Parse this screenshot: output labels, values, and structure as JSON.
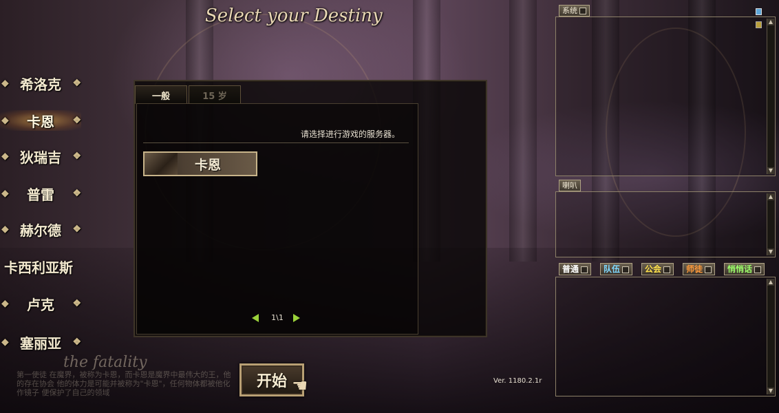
{
  "title": "Select your Destiny",
  "characters": [
    {
      "label": "希洛克",
      "active": false
    },
    {
      "label": "卡恩",
      "active": true
    },
    {
      "label": "狄瑞吉",
      "active": false
    },
    {
      "label": "普雷",
      "active": false
    },
    {
      "label": "赫尔德",
      "active": false
    },
    {
      "label": "卡西利亚斯",
      "active": false
    },
    {
      "label": "卢克",
      "active": false
    },
    {
      "label": "塞丽亚",
      "active": false
    }
  ],
  "background_text": {
    "subtitle": "the fatality",
    "story": "第一使徒 在魔界，被称为卡恩，而卡恩是魔界中最伟大的王，他的存在协会 他的体力是可能并被称为\"卡恩\"，任何物体都被他化作镜子 便保护了自己的领域"
  },
  "panel": {
    "tabs": [
      {
        "label": "一般",
        "active": true
      },
      {
        "label": "15 岁",
        "active": false
      }
    ],
    "instruction": "请选择进行游戏的服务器。",
    "servers": [
      {
        "name": "卡恩"
      }
    ],
    "pager": {
      "text": "1\\1"
    }
  },
  "start_button": {
    "label": "开始"
  },
  "version": "Ver. 1180.2.1r",
  "right_panel": {
    "system_label": "系统",
    "speaker_label": "喇叭",
    "channels": [
      {
        "label": "普通",
        "color": "#ffffff"
      },
      {
        "label": "队伍",
        "color": "#7fd8ff"
      },
      {
        "label": "公会",
        "color": "#ffe14a"
      },
      {
        "label": "师徒",
        "color": "#ff9a3a"
      },
      {
        "label": "悄悄话",
        "color": "#9cff6a"
      }
    ]
  }
}
